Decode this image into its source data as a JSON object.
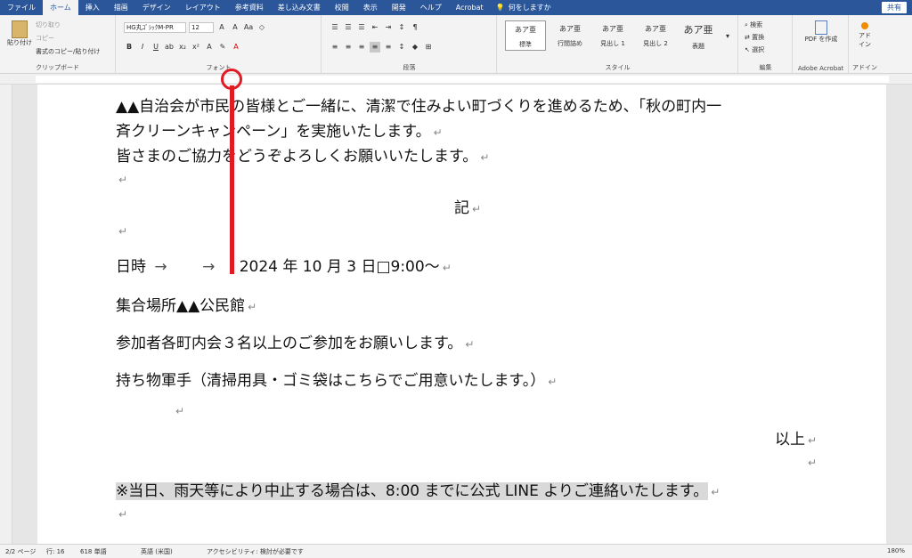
{
  "tabs": [
    "ファイル",
    "ホーム",
    "挿入",
    "描画",
    "デザイン",
    "レイアウト",
    "参考資料",
    "差し込み文書",
    "校閲",
    "表示",
    "開発",
    "ヘルプ",
    "Acrobat"
  ],
  "tell_me": "何をしますか",
  "share": "共有",
  "clipboard": {
    "paste": "貼り付け",
    "cut": "切り取り",
    "copy": "コピー",
    "format_painter": "書式のコピー/貼り付け",
    "label": "クリップボード"
  },
  "font": {
    "name": "HG丸ｺﾞｼｯｸM-PR",
    "size": "12",
    "label": "フォント"
  },
  "paragraph_label": "段落",
  "styles": [
    {
      "preview": "あア亜",
      "name": "標準"
    },
    {
      "preview": "あア亜",
      "name": "行間詰め"
    },
    {
      "preview": "あア亜",
      "name": "見出し 1"
    },
    {
      "preview": "あア亜",
      "name": "見出し 2"
    },
    {
      "preview": "あア亜",
      "name": "表題"
    }
  ],
  "styles_label": "スタイル",
  "editing": {
    "find": "検索",
    "replace": "置換",
    "select": "選択",
    "label": "編集"
  },
  "acrobat": {
    "create_pdf": "PDF を作成",
    "label": "Adobe Acrobat"
  },
  "addin": {
    "button": "アド イン",
    "label": "アドイン"
  },
  "doc": {
    "p1": "▲▲自治会が市民の皆様とご一緒に、清潔で住みよい町づくりを進めるため、「秋の町内一",
    "p2": "斉クリーンキャンペーン」を実施いたします。",
    "p3": "皆さまのご協力をどうぞよろしくお願いいたします。",
    "ki": "記",
    "date_label": "日時",
    "date_value": "2024 年 10 月 3 日□9:00～",
    "place": "集合場所▲▲公民館",
    "participants": "参加者各町内会３名以上のご参加をお願いします。",
    "items": "持ち物軍手（清掃用具・ゴミ袋はこちらでご用意いたします。）",
    "ijou": "以上",
    "note": "※当日、雨天等により中止する場合は、8:00 までに公式 LINE よりご連絡いたします。"
  },
  "status": {
    "page": "2/2 ページ",
    "line": "行: 16",
    "words": "618 単語",
    "lang": "英語 (米国)",
    "access": "アクセシビリティ: 検討が必要です",
    "zoom": "180%"
  },
  "colors": {
    "brand": "#2b579a",
    "annotation": "#e01b24"
  }
}
